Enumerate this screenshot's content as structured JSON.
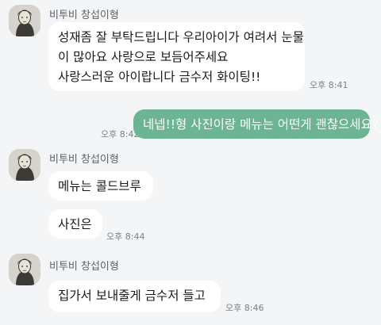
{
  "chat": {
    "sender_name": "비투비 창섭이형",
    "messages": [
      {
        "lines": [
          "성재좀 잘 부탁드립니다 우리아이가 여려서 눈물",
          "이 많아요 사랑으로 보듬어주세요",
          "사랑스러운 아이랍니다 금수저 화이팅!!"
        ],
        "time": "오후 8:41"
      },
      {
        "text": "네넵!!형 사진이랑 메뉴는 어떤게 괜찮으세요?",
        "time": "오후 8:42"
      },
      {
        "text": "메뉴는 콜드브루"
      },
      {
        "text": "사진은",
        "time": "오후 8:44"
      },
      {
        "text": "집가서 보내줄게 금수저 들고",
        "time": "오후 8:46"
      }
    ]
  },
  "colors": {
    "background": "#f4f5f6",
    "received_bubble": "#ffffff",
    "sent_bubble": "#6cb493"
  },
  "icons": {
    "avatar": "profile-photo"
  }
}
